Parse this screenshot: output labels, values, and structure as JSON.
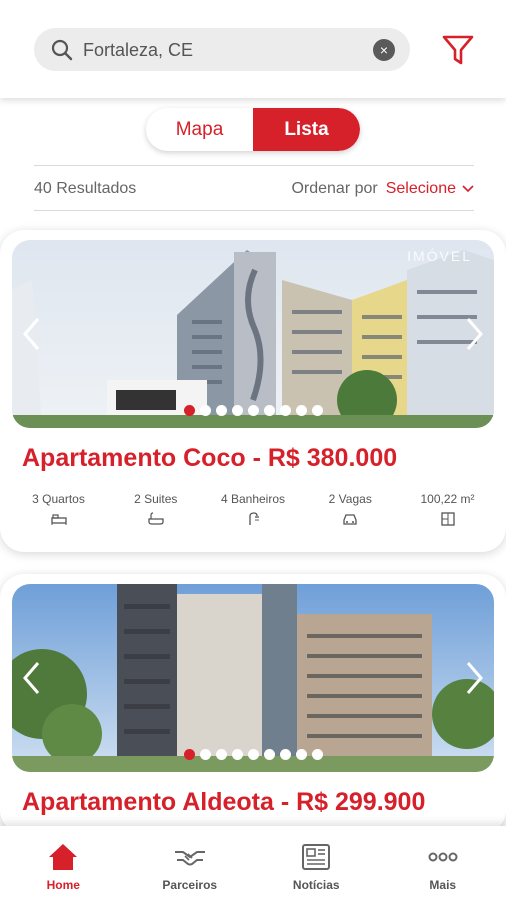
{
  "search": {
    "value": "Fortaleza, CE",
    "clear_symbol": "×"
  },
  "view_toggle": {
    "options": [
      "Mapa",
      "Lista"
    ],
    "selected": "Lista"
  },
  "results": {
    "count_text": "40 Resultados",
    "sort_label": "Ordenar por",
    "sort_value": "Selecione"
  },
  "colors": {
    "accent": "#d6202a",
    "search_bg": "#ececec"
  },
  "listings": [
    {
      "title": "Apartamento Coco - R$ 380.000",
      "watermark": "IMÓVEL",
      "photo_count": 9,
      "active_photo": 1,
      "features": [
        {
          "label": "3 Quartos",
          "icon": "bed-icon"
        },
        {
          "label": "2 Suites",
          "icon": "bathtub-icon"
        },
        {
          "label": "4 Banheiros",
          "icon": "shower-icon"
        },
        {
          "label": "2 Vagas",
          "icon": "car-icon"
        },
        {
          "label": "100,22 m²",
          "icon": "area-icon"
        }
      ]
    },
    {
      "title": "Apartamento Aldeota - R$ 299.900",
      "photo_count": 9,
      "active_photo": 1
    }
  ],
  "bottom_nav": [
    {
      "label": "Home",
      "icon": "home-icon",
      "active": true
    },
    {
      "label": "Parceiros",
      "icon": "handshake-icon",
      "active": false
    },
    {
      "label": "Notícias",
      "icon": "newspaper-icon",
      "active": false
    },
    {
      "label": "Mais",
      "icon": "more-dots-icon",
      "active": false
    }
  ]
}
